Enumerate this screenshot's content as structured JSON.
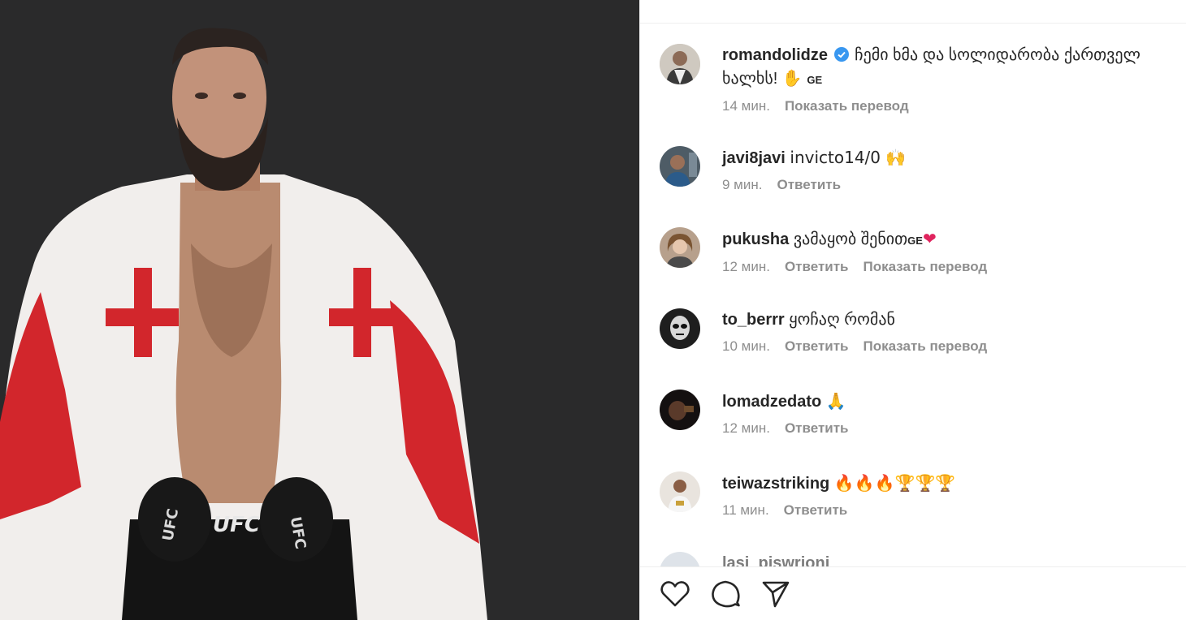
{
  "post": {
    "author": "romandolidze",
    "caption": "ჩემი ხმა და სოლიდარობა ქართველ ხალხს! ✋",
    "caption_flag": "GE",
    "time": "14 мин.",
    "translate": "Показать перевод"
  },
  "comments": [
    {
      "user": "javi8javi",
      "text": "invicto14/0 🙌",
      "time": "9 мин.",
      "reply": "Ответить"
    },
    {
      "user": "pukusha",
      "text": "ვამაყობ შენით",
      "flag": "GE",
      "heart": "❤",
      "time": "12 мин.",
      "reply": "Ответить",
      "translate": "Показать перевод"
    },
    {
      "user": "to_berrr",
      "text": "ყოჩაღ რომან",
      "time": "10 мин.",
      "reply": "Ответить",
      "translate": "Показать перевод"
    },
    {
      "user": "lomadzedato",
      "text": "🙏",
      "time": "12 мин.",
      "reply": "Ответить"
    },
    {
      "user": "teiwazstriking",
      "text": "🔥🔥🔥🏆🏆🏆",
      "time": "11 мин.",
      "reply": "Ответить"
    }
  ],
  "partial_comment": {
    "user": "lasi_piswrioni"
  },
  "icons": {
    "like": "heart-icon",
    "comment": "comment-icon",
    "share": "share-icon"
  },
  "colors": {
    "verified": "#3897f0",
    "meta": "#8e8e8e",
    "text": "#262626"
  }
}
